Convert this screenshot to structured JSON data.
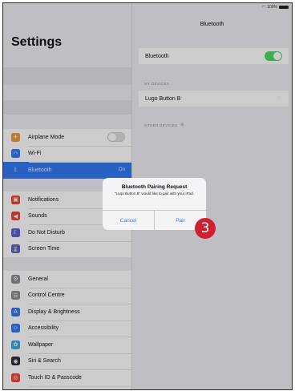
{
  "status": {
    "battery": "100%"
  },
  "sidebar": {
    "title": "Settings",
    "group1": [
      {
        "label": "Airplane Mode",
        "color": "#f09a37",
        "glyph": "✈"
      },
      {
        "label": "Wi-Fi",
        "color": "#3478f6",
        "glyph": "◠"
      },
      {
        "label": "Bluetooth",
        "color": "#3478f6",
        "glyph": "ᛒ",
        "value": "On"
      }
    ],
    "group2": [
      {
        "label": "Notifications",
        "color": "#f0443a",
        "glyph": "▣"
      },
      {
        "label": "Sounds",
        "color": "#f0443a",
        "glyph": "◀"
      },
      {
        "label": "Do Not Disturb",
        "color": "#5b5fd6",
        "glyph": "☾"
      },
      {
        "label": "Screen Time",
        "color": "#5b5fd6",
        "glyph": "⌛"
      }
    ],
    "group3": [
      {
        "label": "General",
        "color": "#8e8e93",
        "glyph": "⚙"
      },
      {
        "label": "Control Centre",
        "color": "#8e8e93",
        "glyph": "☰"
      },
      {
        "label": "Display & Brightness",
        "color": "#3478f6",
        "glyph": "A"
      },
      {
        "label": "Accessibility",
        "color": "#3478f6",
        "glyph": "☺"
      },
      {
        "label": "Wallpaper",
        "color": "#38a9e0",
        "glyph": "✿"
      },
      {
        "label": "Siri & Search",
        "color": "#303040",
        "glyph": "◉"
      },
      {
        "label": "Touch ID & Passcode",
        "color": "#f0443a",
        "glyph": "◎"
      }
    ]
  },
  "detail": {
    "title": "Bluetooth",
    "bluetooth_label": "Bluetooth",
    "my_devices_header": "MY DEVICES",
    "device_name": "Lugo Button B",
    "other_devices_header": "OTHER DEVICES"
  },
  "alert": {
    "title": "Bluetooth Pairing Request",
    "message": "“Luqo Button B” would like to pair with your iPad.",
    "cancel_label": "Cancel",
    "pair_label": "Pair"
  },
  "callout": {
    "number": "3"
  }
}
